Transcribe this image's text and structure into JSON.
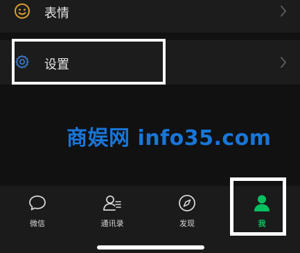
{
  "menu": {
    "emoji_label": "表情",
    "settings_label": "设置"
  },
  "watermark": "商娱网 info35.com",
  "tabs": [
    {
      "label": "微信",
      "icon": "chat-bubble-icon"
    },
    {
      "label": "通讯录",
      "icon": "contacts-icon"
    },
    {
      "label": "发现",
      "icon": "compass-icon"
    },
    {
      "label": "我",
      "icon": "person-icon"
    }
  ],
  "colors": {
    "accent_green": "#07c160",
    "watermark_blue": "#1976d8",
    "settings_icon_blue": "#3b78c6",
    "emoji_icon_orange": "#e0a030"
  }
}
